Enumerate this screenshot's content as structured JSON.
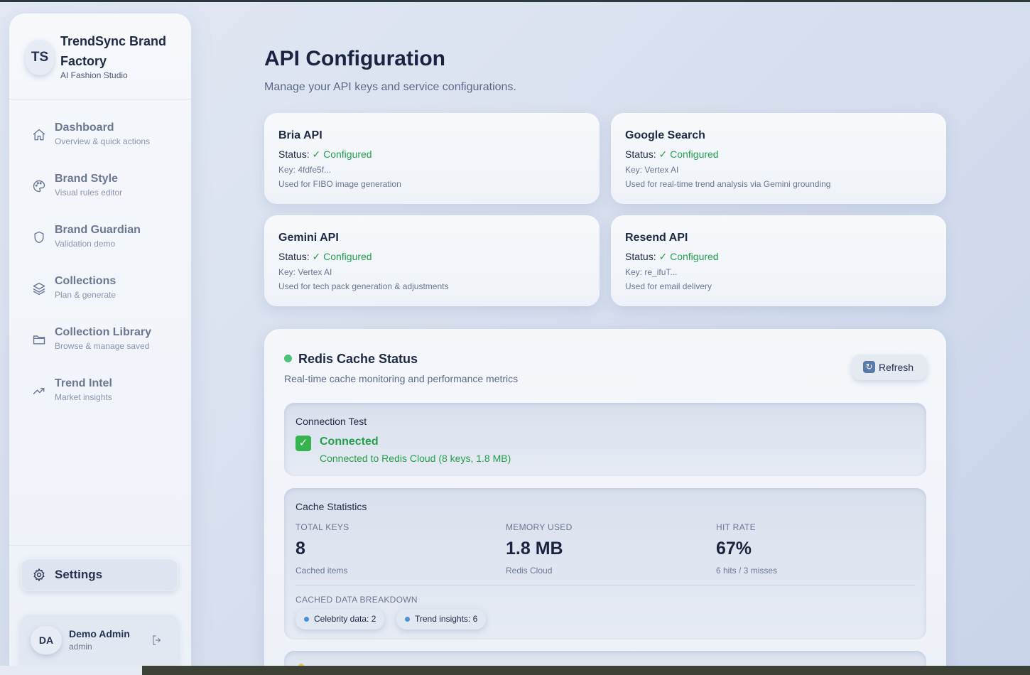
{
  "brand": {
    "initials": "TS",
    "name": "TrendSync Brand Factory",
    "subtitle": "AI Fashion Studio"
  },
  "sidebar": {
    "items": [
      {
        "label": "Dashboard",
        "sub": "Overview & quick actions",
        "icon": "home-icon"
      },
      {
        "label": "Brand Style",
        "sub": "Visual rules editor",
        "icon": "palette-icon"
      },
      {
        "label": "Brand Guardian",
        "sub": "Validation demo",
        "icon": "shield-icon"
      },
      {
        "label": "Collections",
        "sub": "Plan & generate",
        "icon": "layers-icon"
      },
      {
        "label": "Collection Library",
        "sub": "Browse & manage saved",
        "icon": "folder-icon"
      },
      {
        "label": "Trend Intel",
        "sub": "Market insights",
        "icon": "trending-up-icon"
      }
    ],
    "settings_label": "Settings"
  },
  "user": {
    "initials": "DA",
    "name": "Demo Admin",
    "role": "admin"
  },
  "page": {
    "title": "API Configuration",
    "subtitle": "Manage your API keys and service configurations."
  },
  "apis": [
    {
      "name": "Bria API",
      "status_label": "Status:",
      "status": "✓ Configured",
      "key": "Key: 4fdfe5f...",
      "use": "Used for FIBO image generation"
    },
    {
      "name": "Google Search",
      "status_label": "Status:",
      "status": "✓ Configured",
      "key": "Key: Vertex AI",
      "use": "Used for real-time trend analysis via Gemini grounding"
    },
    {
      "name": "Gemini API",
      "status_label": "Status:",
      "status": "✓ Configured",
      "key": "Key: Vertex AI",
      "use": "Used for tech pack generation & adjustments"
    },
    {
      "name": "Resend API",
      "status_label": "Status:",
      "status": "✓ Configured",
      "key": "Key: re_ifuT...",
      "use": "Used for email delivery"
    }
  ],
  "redis": {
    "title": "Redis Cache Status",
    "subtitle": "Real-time cache monitoring and performance metrics",
    "refresh_label": "Refresh",
    "connection": {
      "heading": "Connection Test",
      "state": "Connected",
      "detail": "Connected to Redis Cloud (8 keys, 1.8 MB)"
    },
    "stats": {
      "heading": "Cache Statistics",
      "items": [
        {
          "label": "TOTAL KEYS",
          "value": "8",
          "caption": "Cached items"
        },
        {
          "label": "MEMORY USED",
          "value": "1.8 MB",
          "caption": "Redis Cloud"
        },
        {
          "label": "HIT RATE",
          "value": "67%",
          "caption": "6 hits / 3 misses"
        }
      ],
      "breakdown_heading": "CACHED DATA BREAKDOWN",
      "breakdown": [
        {
          "label": "Celebrity data: 2"
        },
        {
          "label": "Trend insights: 6"
        }
      ]
    }
  },
  "colors": {
    "success": "#22a04a",
    "status_dot": "#4cc27a",
    "chip_dot": "#4a90d9"
  }
}
